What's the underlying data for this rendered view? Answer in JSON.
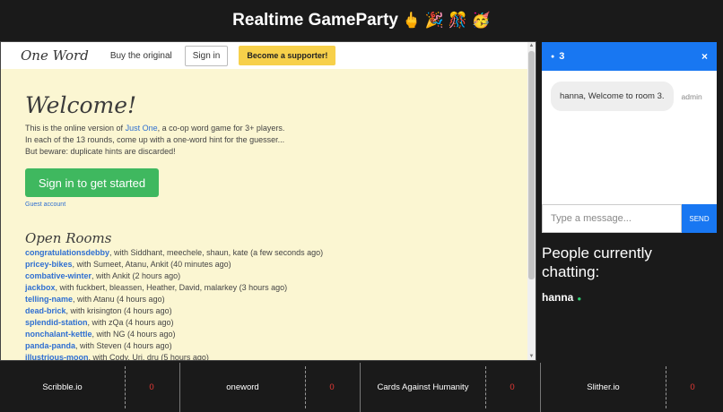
{
  "app": {
    "title": "Realtime GameParty",
    "emojis": "🖕 🎉 🎊 🥳"
  },
  "game": {
    "brand": "One Word",
    "nav": {
      "buy_original": "Buy the original",
      "sign_in": "Sign in",
      "supporter": "Become a supporter!"
    },
    "welcome": "Welcome!",
    "intro": {
      "line1_before": "This is the online version of ",
      "line1_link": "Just One",
      "line1_after": ", a co-op word game for 3+ players.",
      "line2": "In each of the 13 rounds, come up with a one-word hint for the guesser...",
      "line3": "But beware: duplicate hints are discarded!"
    },
    "sign_in_big": "Sign in to get started",
    "guest": "Guest account",
    "open_rooms_title": "Open Rooms",
    "rooms": [
      {
        "name": "congratulationsdebby",
        "detail": ", with Siddhant, meechele, shaun, kate (a few seconds ago)"
      },
      {
        "name": "pricey-bikes",
        "detail": ", with Sumeet, Atanu, Ankit (40 minutes ago)"
      },
      {
        "name": "combative-winter",
        "detail": ", with Ankit (2 hours ago)"
      },
      {
        "name": "jackbox",
        "detail": ", with fuckbert, bleassen, Heather, David, malarkey (3 hours ago)"
      },
      {
        "name": "telling-name",
        "detail": ", with Atanu (4 hours ago)"
      },
      {
        "name": "dead-brick",
        "detail": ", with krisington (4 hours ago)"
      },
      {
        "name": "splendid-station",
        "detail": ", with zQa (4 hours ago)"
      },
      {
        "name": "nonchalant-kettle",
        "detail": ", with NG (4 hours ago)"
      },
      {
        "name": "panda-panda",
        "detail": ", with Steven (4 hours ago)"
      },
      {
        "name": "illustrious-moon",
        "detail": ", with Cody, Uri, dru (5 hours ago)"
      }
    ]
  },
  "chat": {
    "room": "3",
    "close": "×",
    "messages": [
      {
        "text": "hanna, Welcome to room 3.",
        "user": "admin"
      }
    ],
    "input_placeholder": "Type a message...",
    "send": "SEND"
  },
  "people": {
    "title": "People currently chatting:",
    "users": [
      "hanna"
    ]
  },
  "games": [
    {
      "name": "Scribble.io",
      "count": "0"
    },
    {
      "name": "oneword",
      "count": "0"
    },
    {
      "name": "Cards Against Humanity",
      "count": "0"
    },
    {
      "name": "Slither.io",
      "count": "0"
    }
  ],
  "colors": {
    "accent_blue": "#1877f2",
    "link_blue": "#2f6fd1",
    "cta_green": "#3fb85f",
    "supporter_yellow": "#f7d04a",
    "page_cream": "#fbf6d2",
    "count_red": "#e53935",
    "online_green": "#2ecc71"
  }
}
